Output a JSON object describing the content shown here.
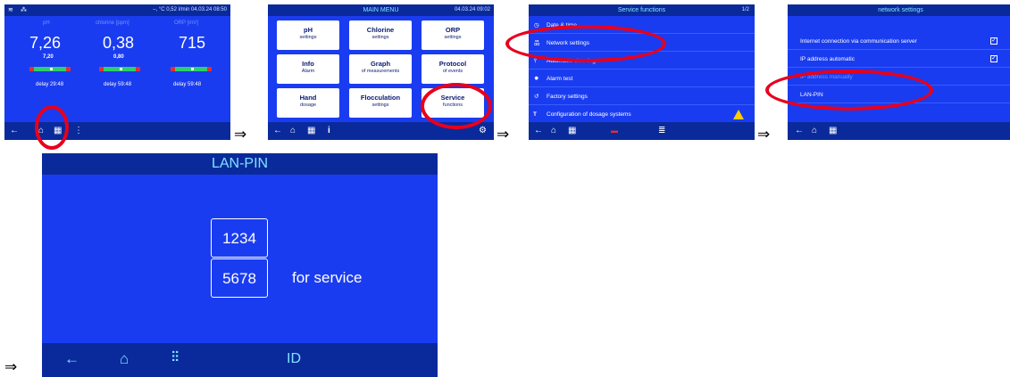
{
  "screen1": {
    "top_status": "–, °C    0,52 l/min    04.03.24 08:50",
    "columns": [
      {
        "label": "pH",
        "value": "7,26",
        "setpoint": "7,20",
        "delay": "delay 29:48"
      },
      {
        "label": "chlorine [ppm]",
        "value": "0,38",
        "setpoint": "0,80",
        "delay": "delay 59:48"
      },
      {
        "label": "ORP [mV]",
        "value": "715",
        "setpoint": "",
        "delay": "delay 59:48"
      }
    ]
  },
  "screen2": {
    "title": "MAIN MENU",
    "datetime": "04.03.24 09:02",
    "tiles": [
      {
        "main": "pH",
        "sub": "settings"
      },
      {
        "main": "Chlorine",
        "sub": "settings"
      },
      {
        "main": "ORP",
        "sub": "settings"
      },
      {
        "main": "Info",
        "sub": "Alarm"
      },
      {
        "main": "Graph",
        "sub": "of measurements"
      },
      {
        "main": "Protocol",
        "sub": "of events"
      },
      {
        "main": "Hand",
        "sub": "dosage"
      },
      {
        "main": "Flocculation",
        "sub": "settings"
      },
      {
        "main": "Service",
        "sub": "functions"
      }
    ],
    "bottom_info": "i"
  },
  "screen3": {
    "title": "Service functions",
    "page": "1/2",
    "items": [
      "Date & time",
      "Network settings",
      "Automatic cleaning",
      "Alarm test",
      "Factory settings",
      "Configuration of dosage systems"
    ],
    "warning_symbol": "!"
  },
  "screen4": {
    "title": "network settings",
    "items": [
      "Internet connection via communication server",
      "IP address automatic",
      "IP address manually",
      "LAN-PIN"
    ]
  },
  "screen5": {
    "title": "LAN-PIN",
    "pin1": "1234",
    "pin2": "5678",
    "service_label": "for service",
    "id_label": "ID"
  },
  "arrow_symbol": "⇒",
  "colors": {
    "screen_bg": "#1a3cf0",
    "bar_bg": "#0a2a9c",
    "highlight_oval": "#e8001c",
    "title_text": "#7fe3ff"
  }
}
